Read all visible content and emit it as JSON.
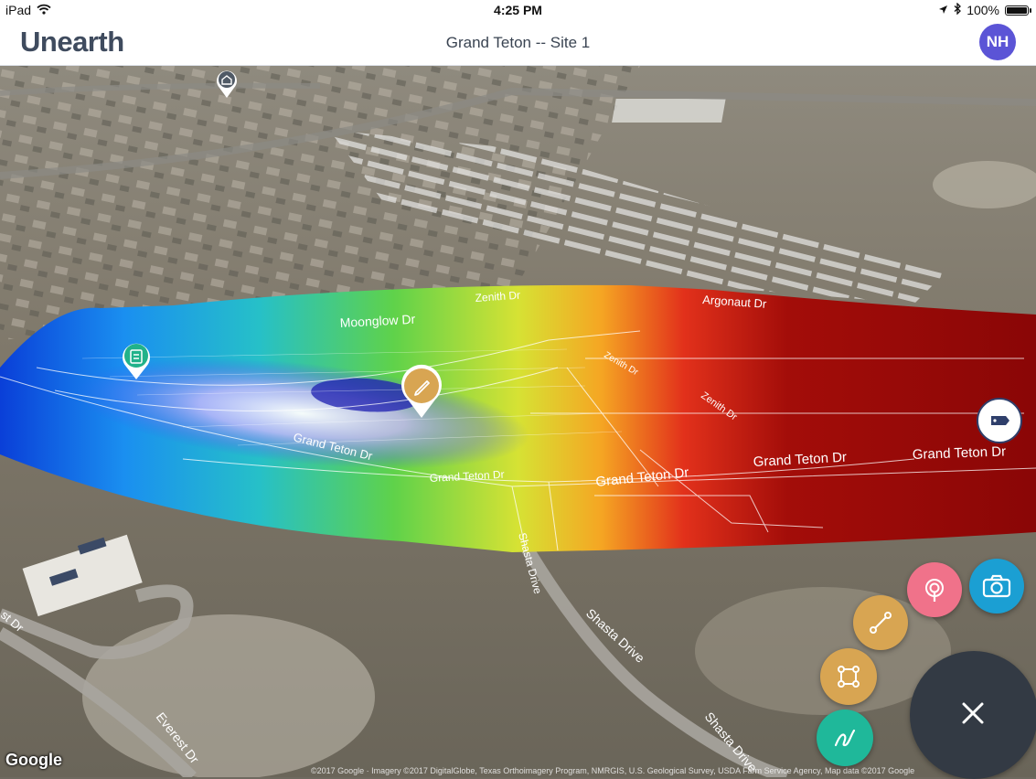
{
  "status_bar": {
    "device": "iPad",
    "time": "4:25 PM",
    "battery": "100%",
    "battery_level": 1.0
  },
  "header": {
    "logo": "Unearth",
    "title": "Grand Teton -- Site 1",
    "avatar_initials": "NH"
  },
  "map": {
    "street_labels": {
      "zenith_dr_top": "Zenith Dr",
      "argonaut_dr": "Argonaut Dr",
      "moonglow_dr": "Moonglow Dr",
      "zenith_dr_curve": "Zenith Dr",
      "zenith_dr_right": "Zenith Dr",
      "grand_teton_1": "Grand Teton Dr",
      "grand_teton_2": "Grand Teton Dr",
      "grand_teton_3": "Grand Teton Dr",
      "grand_teton_4": "Grand Teton Dr",
      "grand_teton_5": "Grand Teton Dr",
      "shasta_drive_1": "Shasta Drive",
      "shasta_drive_2": "Shasta Drive",
      "shasta_drive_3": "Shasta Drive",
      "everest_dr_1": "Everest Dr",
      "everest_dr_2": "st Dr"
    },
    "google_logo": "Google",
    "attribution": "©2017 Google · Imagery ©2017 DigitalGlobe, Texas Orthoimagery Program, NMRGIS, U.S. Geological Survey, USDA Farm Service Agency, Map data ©2017 Google",
    "pins": [
      {
        "name": "place-pin",
        "icon": "house-icon",
        "color": "#505a66"
      },
      {
        "name": "note-pin",
        "icon": "clipboard-icon",
        "color": "#21b28a"
      },
      {
        "name": "edit-pin",
        "icon": "pencil-icon",
        "color": "#d8a552"
      },
      {
        "name": "tag-pin",
        "icon": "tag-icon",
        "color": "#2f3f6b"
      }
    ]
  },
  "actions": {
    "camera": {
      "icon": "camera-icon",
      "color": "#1b9fd3"
    },
    "location": {
      "icon": "location-pin-icon",
      "color": "#f0728a"
    },
    "line": {
      "icon": "line-tool-icon",
      "color": "#d8a552"
    },
    "polygon": {
      "icon": "polygon-tool-icon",
      "color": "#d8a552"
    },
    "freehand": {
      "icon": "freehand-tool-icon",
      "color": "#1fb89a"
    },
    "close": {
      "icon": "close-icon",
      "color": "#333a44"
    }
  }
}
